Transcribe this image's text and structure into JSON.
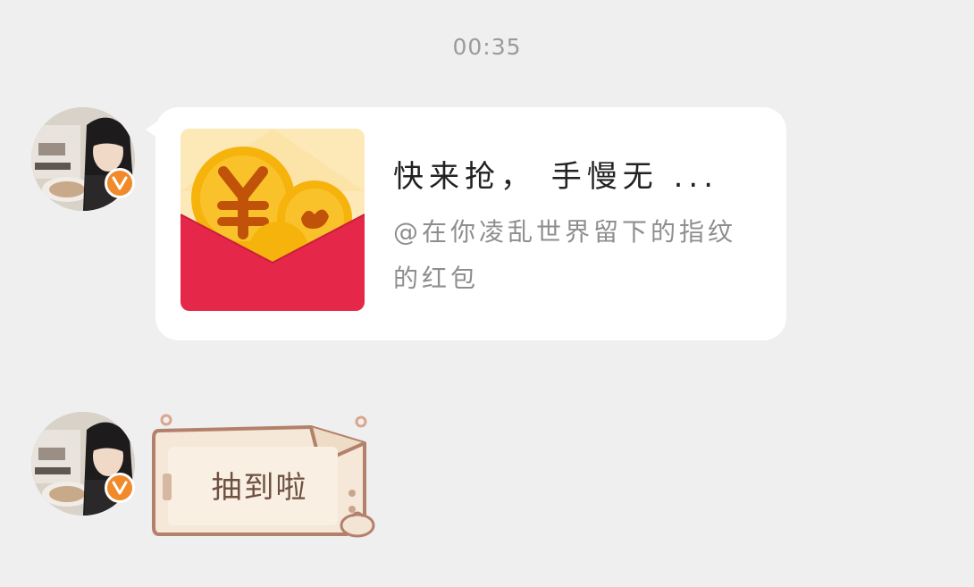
{
  "chat": {
    "timestamp": "00:35",
    "messages": [
      {
        "type": "red_packet",
        "avatar_icon": "user-avatar",
        "badge_icon": "verified-v-icon",
        "title": "快来抢， 手慢无 ...",
        "subtitle": "@在你凌乱世界留下的指纹的红包"
      },
      {
        "type": "sticker",
        "avatar_icon": "user-avatar",
        "badge_icon": "verified-v-icon",
        "text": "抽到啦"
      }
    ]
  },
  "colors": {
    "background": "#efefef",
    "bubble": "#ffffff",
    "red_packet": "#e5284a",
    "coin": "#f6b30c",
    "badge": "#f08a2b",
    "sticker_border": "#b3816b",
    "sticker_fill": "#f5e8d8"
  }
}
